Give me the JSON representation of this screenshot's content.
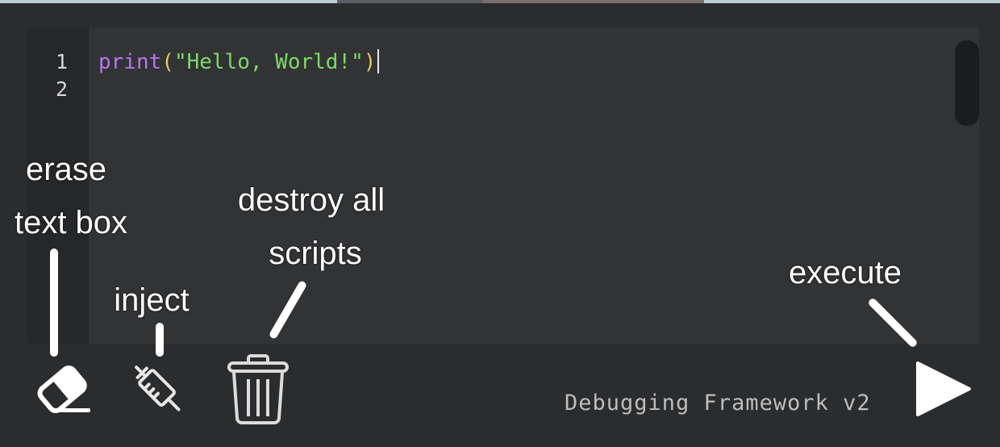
{
  "editor": {
    "line_numbers": [
      "1",
      "2"
    ],
    "code": {
      "fn": "print",
      "open_paren": "(",
      "string": "\"Hello, World!\"",
      "close_paren": ")"
    }
  },
  "toolbar": {
    "erase_icon": "eraser-icon",
    "inject_icon": "syringe-icon",
    "destroy_icon": "trash-icon",
    "execute_icon": "play-icon"
  },
  "status": {
    "label": "Debugging Framework v2"
  },
  "annotations": {
    "erase_line1": "erase",
    "erase_line2": "text box",
    "inject": "inject",
    "destroy_line1": "destroy all",
    "destroy_line2": "scripts",
    "execute": "execute"
  },
  "colors": {
    "background": "#2b2c2e",
    "editor_bg": "#323335",
    "gutter_bg": "#262729",
    "fn": "#b676ee",
    "paren": "#e3c95a",
    "string": "#7fd86a",
    "status_text": "#bdbdbd"
  }
}
